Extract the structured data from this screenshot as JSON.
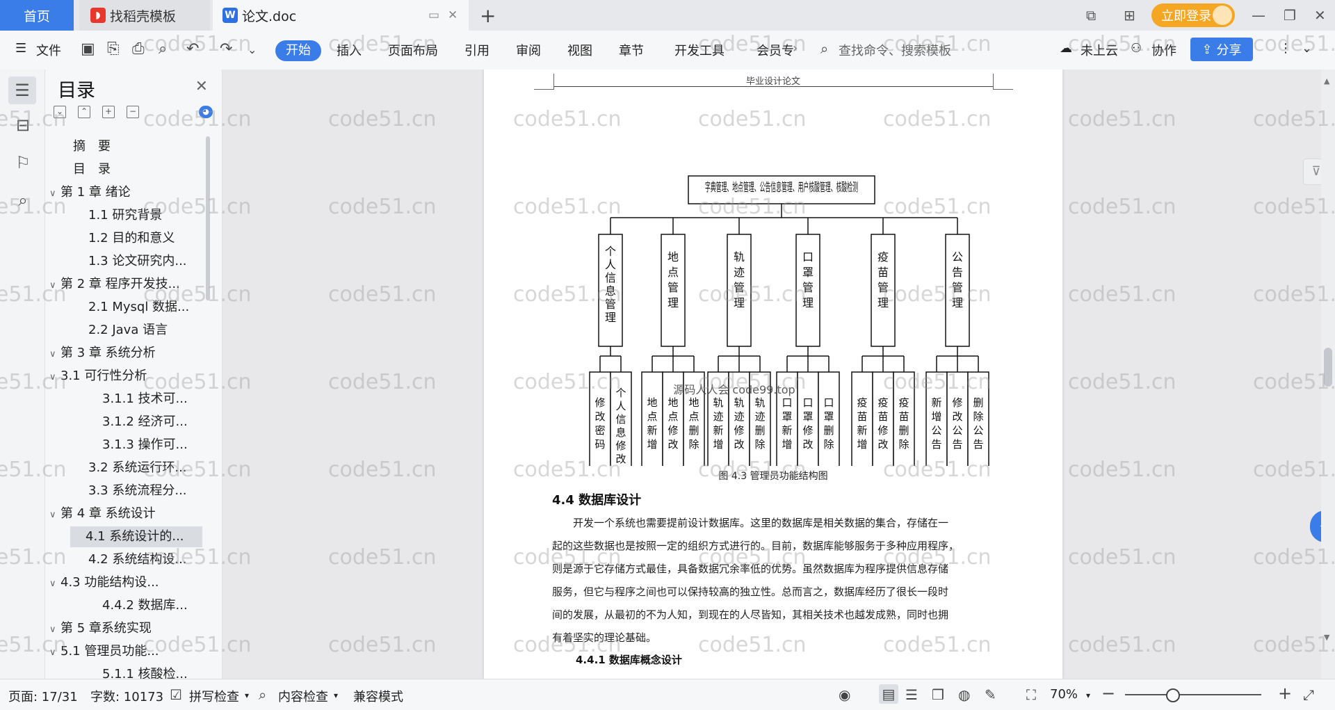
{
  "titlebar": {
    "tabs": [
      {
        "label": "首页"
      },
      {
        "label": "找稻壳模板"
      },
      {
        "label": "论文.doc"
      }
    ],
    "login_label": "立即登录"
  },
  "ribbon": {
    "file_label": "文件",
    "menus": [
      "开始",
      "插入",
      "页面布局",
      "引用",
      "审阅",
      "视图",
      "章节",
      "开发工具",
      "会员专"
    ],
    "search_placeholder": "查找命令、搜索模板",
    "cloud_label": "未上云",
    "collab_label": "协作",
    "share_label": "分享"
  },
  "toc": {
    "title": "目录",
    "items": [
      {
        "label": "摘　要",
        "level": 1,
        "arrow": ""
      },
      {
        "label": "目　录",
        "level": 1,
        "arrow": ""
      },
      {
        "label": "第 1 章  绪论",
        "level": 0,
        "arrow": "∨"
      },
      {
        "label": "1.1  研究背景",
        "level": 2,
        "arrow": ""
      },
      {
        "label": "1.2 目的和意义",
        "level": 2,
        "arrow": ""
      },
      {
        "label": "1.3  论文研究内...",
        "level": 2,
        "arrow": ""
      },
      {
        "label": "第 2 章  程序开发技...",
        "level": 0,
        "arrow": "∨"
      },
      {
        "label": "2.1 Mysql 数据...",
        "level": 2,
        "arrow": ""
      },
      {
        "label": "2.2 Java 语言",
        "level": 2,
        "arrow": ""
      },
      {
        "label": "第 3 章  系统分析",
        "level": 0,
        "arrow": "∨"
      },
      {
        "label": "3.1 可行性分析",
        "level": 1,
        "arrow": "∨"
      },
      {
        "label": "3.1.1 技术可...",
        "level": 3,
        "arrow": ""
      },
      {
        "label": "3.1.2 经济可...",
        "level": 3,
        "arrow": ""
      },
      {
        "label": "3.1.3 操作可...",
        "level": 3,
        "arrow": ""
      },
      {
        "label": "3.2 系统运行环...",
        "level": 2,
        "arrow": ""
      },
      {
        "label": "3.3 系统流程分...",
        "level": 2,
        "arrow": ""
      },
      {
        "label": "第 4 章  系统设计",
        "level": 0,
        "arrow": "∨"
      },
      {
        "label": "4.1  系统设计的...",
        "level": 2,
        "arrow": "",
        "selected": true
      },
      {
        "label": "4.2  系统结构设...",
        "level": 2,
        "arrow": ""
      },
      {
        "label": "4.3 功能结构设...",
        "level": 1,
        "arrow": "∨"
      },
      {
        "label": "4.4.2  数据库...",
        "level": 3,
        "arrow": ""
      },
      {
        "label": "第 5 章系统实现",
        "level": 0,
        "arrow": "∨"
      },
      {
        "label": "5.1 管理员功能...",
        "level": 1,
        "arrow": "∨"
      },
      {
        "label": "5.1.1  核酸检...",
        "level": 3,
        "arrow": ""
      }
    ]
  },
  "document": {
    "header": "毕业设计论文",
    "diagram": {
      "root": "字典管理、地点管理、公告信息管理、用户核酸管理、核酸检测",
      "branches": [
        {
          "label": "个人信息管理",
          "children": [
            "修改密码",
            "个人信息修改"
          ]
        },
        {
          "label": "地点管理",
          "children": [
            "地点新增",
            "地点修改",
            "地点删除"
          ]
        },
        {
          "label": "轨迹管理",
          "children": [
            "轨迹新增",
            "轨迹修改",
            "轨迹删除"
          ]
        },
        {
          "label": "口罩管理",
          "children": [
            "口罩新增",
            "口罩修改",
            "口罩删除"
          ]
        },
        {
          "label": "疫苗管理",
          "children": [
            "疫苗新增",
            "疫苗修改",
            "疫苗删除"
          ]
        },
        {
          "label": "公告管理",
          "children": [
            "新增公告",
            "修改公告",
            "删除公告"
          ]
        }
      ],
      "overlay_text": "源码人人会 code99.top"
    },
    "caption": "图 4.3  管理员功能结构图",
    "section_title": "4.4  数据库设计",
    "paragraph_lines": [
      "开发一个系统也需要提前设计数据库。这里的数据库是相关数据的集合，存储在一",
      "起的这些数据也是按照一定的组织方式进行的。目前，数据库能够服务于多种应用程序，",
      "则是源于它存储方式最佳，具备数据冗余率低的优势。虽然数据库为程序提供信息存储",
      "服务，但它与程序之间也可以保持较高的独立性。总而言之，数据库经历了很长一段时",
      "间的发展，从最初的不为人知，到现在的人尽皆知，其相关技术也越发成熟，同时也拥",
      "有着坚实的理论基础。"
    ],
    "subsection_title": "4.4.1  数据库概念设计"
  },
  "watermark": "code51.cn",
  "statusbar": {
    "page": "页面: 17/31",
    "words": "字数: 10173",
    "spell": "拼写检查",
    "content_check": "内容检查",
    "compat": "兼容模式",
    "zoom": "70%"
  },
  "colors": {
    "accent": "#3b7de8",
    "login": "#f5a623"
  }
}
